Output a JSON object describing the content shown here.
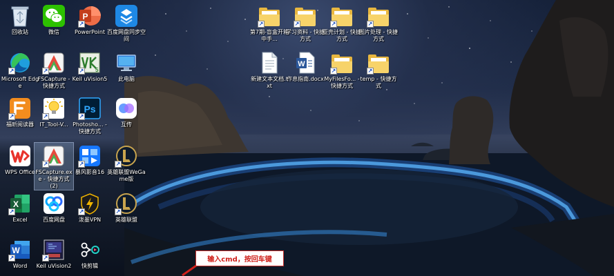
{
  "desktop": {
    "icons": [
      {
        "label": "回收站",
        "icon": "recycle-bin-icon"
      },
      {
        "label": "微信",
        "icon": "wechat-icon"
      },
      {
        "label": "PowerPoint",
        "icon": "powerpoint-icon"
      },
      {
        "label": "百度网盘同步空间",
        "icon": "baidu-sync-icon"
      },
      {
        "label": "第7期-盲盒开箱中手...",
        "icon": "folder-icon"
      },
      {
        "label": "学习资料 - 快捷方式",
        "icon": "folder-icon"
      },
      {
        "label": "亚壳计划 - 快捷方式",
        "icon": "folder-icon"
      },
      {
        "label": "图片处理 - 快捷方式",
        "icon": "folder-icon"
      },
      {
        "label": "Microsoft Edge",
        "icon": "edge-icon"
      },
      {
        "label": "FSCapture - 快捷方式",
        "icon": "fscapture-icon"
      },
      {
        "label": "Keil uVision5",
        "icon": "keil-icon"
      },
      {
        "label": "此电脑",
        "icon": "this-pc-icon"
      },
      {
        "label": "新建文本文档.txt",
        "icon": "text-file-icon"
      },
      {
        "label": "作息指南.docx",
        "icon": "word-doc-icon"
      },
      {
        "label": "MyFilesFo... - 快捷方式",
        "icon": "folder-icon"
      },
      {
        "label": "temp - 快捷方式",
        "icon": "folder-icon"
      },
      {
        "label": "福昕阅读器",
        "icon": "foxit-reader-icon"
      },
      {
        "label": "IT_Tool-V...",
        "icon": "lightbulb-icon"
      },
      {
        "label": "Photosho... - 快捷方式",
        "icon": "photoshop-icon"
      },
      {
        "label": "互传",
        "icon": "hucuan-icon"
      },
      {
        "label": "WPS Office",
        "icon": "wps-icon"
      },
      {
        "label": "FSCapture.exe - 快捷方式 (2)",
        "icon": "fscapture-icon"
      },
      {
        "label": "暴风影音16",
        "icon": "storm-player-icon"
      },
      {
        "label": "英雄联盟WeGame版",
        "icon": "lol-icon"
      },
      {
        "label": "Excel",
        "icon": "excel-icon"
      },
      {
        "label": "百度网盘",
        "icon": "baidu-netdisk-icon"
      },
      {
        "label": "泼墨VPN",
        "icon": "vpn-icon"
      },
      {
        "label": "英雄联盟",
        "icon": "lol-icon"
      },
      {
        "label": "Word",
        "icon": "word-icon"
      },
      {
        "label": "Keil uVision2",
        "icon": "keil2-icon"
      },
      {
        "label": "快剪辑",
        "icon": "kuaijianji-icon"
      }
    ],
    "callout_text": "输入cmd，按回车键"
  }
}
